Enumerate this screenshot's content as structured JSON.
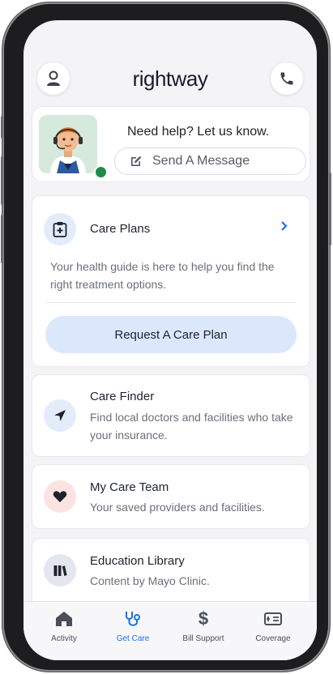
{
  "header": {
    "logo": "rightway",
    "profile_icon": "person-icon",
    "phone_icon": "phone-icon"
  },
  "help": {
    "title": "Need help? Let us know.",
    "message_button": "Send A Message",
    "status_color": "#1e8a4c"
  },
  "care_plans": {
    "title": "Care Plans",
    "description": "Your health guide is here to help you find the right treatment options.",
    "cta": "Request A Care Plan"
  },
  "care_finder": {
    "title": "Care Finder",
    "description": "Find local doctors and facilities who take your insurance."
  },
  "care_team": {
    "title": "My Care Team",
    "description": "Your saved providers and facilities."
  },
  "education": {
    "title": "Education Library",
    "description": "Content by Mayo Clinic."
  },
  "tabs": [
    {
      "label": "Activity",
      "icon": "home-icon",
      "active": false
    },
    {
      "label": "Get Care",
      "icon": "stethoscope-icon",
      "active": true
    },
    {
      "label": "Bill Support",
      "icon": "dollar-icon",
      "active": false
    },
    {
      "label": "Coverage",
      "icon": "id-card-icon",
      "active": false
    }
  ],
  "colors": {
    "accent": "#1a73e8",
    "cta_bg": "#dbe8fb",
    "screen_bg": "#f4f4f6"
  }
}
